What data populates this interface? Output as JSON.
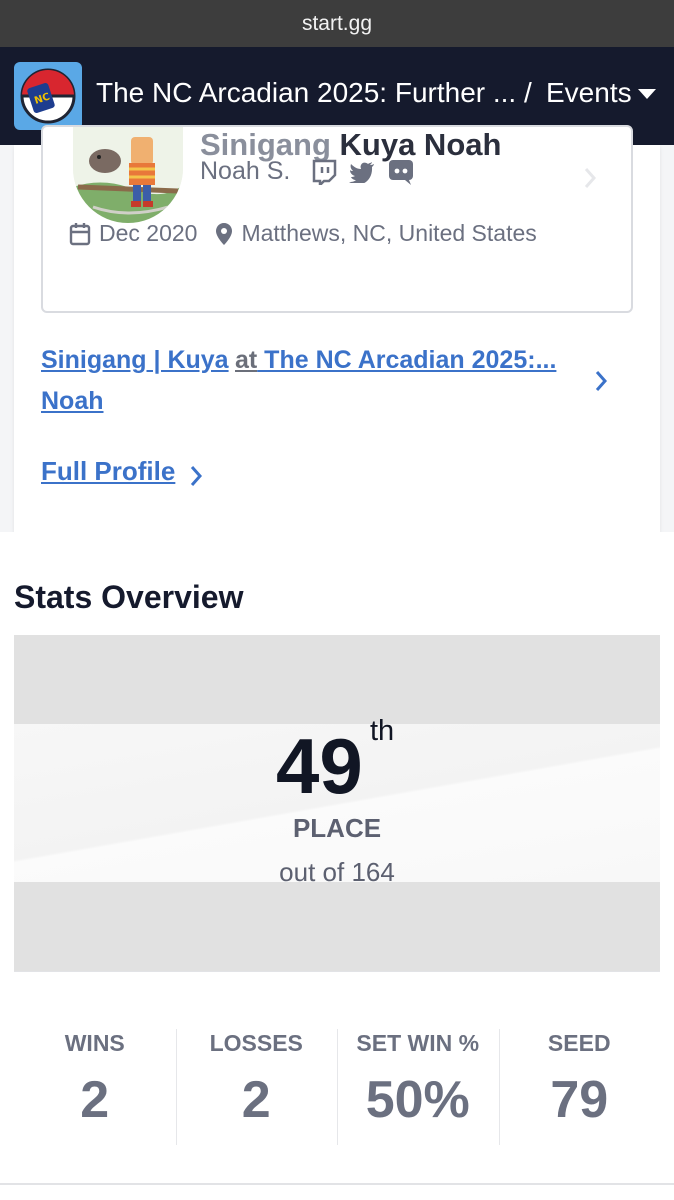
{
  "browser": {
    "url": "start.gg"
  },
  "header": {
    "title": "The NC Arcadian 2025: Further ...",
    "separator": "/",
    "section": "Events"
  },
  "profile": {
    "prefix": "Sinigang",
    "gamertag": "Kuya Noah",
    "real_name": "Noah S.",
    "socials": [
      "twitch-icon",
      "twitter-icon",
      "discord-icon"
    ],
    "joined": "Dec 2020",
    "location": "Matthews, NC, United States"
  },
  "entrant_link": {
    "name_line1": "Sinigang | Kuya",
    "name_line2": "Noah",
    "at_word": "at",
    "event": " The NC Arcadian 2025:..."
  },
  "full_profile_label": "Full Profile",
  "stats": {
    "title": "Stats Overview",
    "place": "49",
    "place_suffix": "th",
    "place_label": "PLACE",
    "out_of": "out of 164",
    "items": [
      {
        "label": "WINS",
        "value": "2"
      },
      {
        "label": "LOSSES",
        "value": "2"
      },
      {
        "label": "SET WIN %",
        "value": "50%"
      },
      {
        "label": "SEED",
        "value": "79"
      }
    ]
  },
  "colors": {
    "header_bg": "#151a2d",
    "link": "#3b72c9",
    "muted": "#6b7080"
  }
}
